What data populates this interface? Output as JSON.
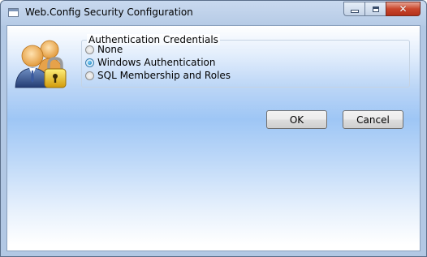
{
  "window": {
    "title": "Web.Config Security Configuration",
    "icon": "window-icon"
  },
  "caption_buttons": {
    "minimize_icon": "minimize-icon",
    "maximize_icon": "maximize-icon",
    "close_icon": "close-icon",
    "close_glyph": "✕"
  },
  "authentication": {
    "legend": "Authentication Credentials",
    "options": [
      {
        "label": "None",
        "selected": false
      },
      {
        "label": "Windows Authentication",
        "selected": true
      },
      {
        "label": "SQL Membership and Roles",
        "selected": false
      }
    ]
  },
  "buttons": {
    "ok_label": "OK",
    "cancel_label": "Cancel"
  },
  "colors": {
    "accent": "#3c7fb1",
    "client_gradient_mid": "#9ec6f5",
    "close_red": "#c9462c"
  }
}
